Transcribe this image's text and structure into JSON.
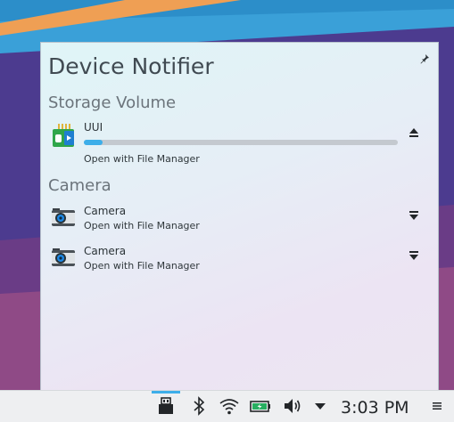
{
  "popup": {
    "title": "Device Notifier",
    "sections": [
      {
        "label": "Storage Volume",
        "devices": [
          {
            "name": "UUI",
            "subtitle": "Open with File Manager",
            "icon": "usb-drive-icon",
            "action": "eject-icon",
            "usage": 0.06
          }
        ]
      },
      {
        "label": "Camera",
        "devices": [
          {
            "name": "Camera",
            "subtitle": "Open with File Manager",
            "icon": "camera-icon",
            "action": "chevron-down-icon"
          },
          {
            "name": "Camera",
            "subtitle": "Open with File Manager",
            "icon": "camera-icon",
            "action": "chevron-down-icon"
          }
        ]
      }
    ],
    "pin_icon": "pin-icon"
  },
  "taskbar": {
    "clock": "3:03 PM",
    "tray_icons": [
      "device-notifier-icon",
      "bluetooth-icon",
      "wifi-icon",
      "battery-icon",
      "volume-icon",
      "expand-tray-icon",
      "menu-icon"
    ]
  },
  "colors": {
    "accent": "#3daee9",
    "panel": "#eeeff1"
  }
}
